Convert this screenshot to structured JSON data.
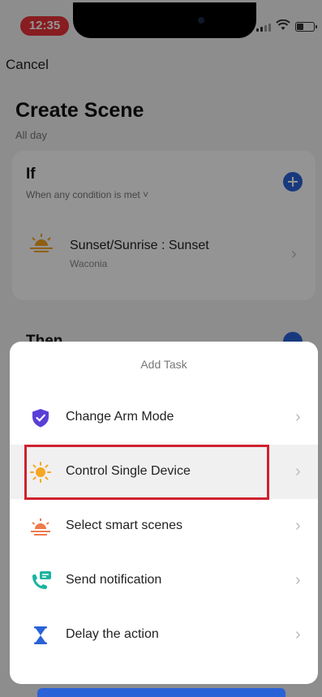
{
  "status_bar": {
    "time": "12:35",
    "battery_level": 0.4,
    "time_bg": "#e8323a"
  },
  "header": {
    "cancel_label": "Cancel",
    "title": "Create Scene",
    "subtitle": "All day"
  },
  "if_section": {
    "title": "If",
    "subtitle": "When any condition is met ˅",
    "condition": {
      "title": "Sunset/Sunrise : Sunset",
      "location": "Waconia",
      "icon": "sunset-icon"
    }
  },
  "then_section": {
    "title": "Then"
  },
  "add_task_sheet": {
    "title": "Add Task",
    "items": [
      {
        "label": "Change Arm Mode",
        "icon": "shield-icon"
      },
      {
        "label": "Control Single Device",
        "icon": "sun-icon",
        "highlighted": true
      },
      {
        "label": "Select smart scenes",
        "icon": "sunset-icon"
      },
      {
        "label": "Send notification",
        "icon": "phone-message-icon"
      },
      {
        "label": "Delay the action",
        "icon": "hourglass-icon"
      }
    ]
  },
  "colors": {
    "accent": "#2a62d8",
    "highlight_border": "#d0212e",
    "icon_orange": "#f5a623",
    "icon_purple": "#5a3fd6",
    "icon_teal": "#1bb3a0"
  }
}
